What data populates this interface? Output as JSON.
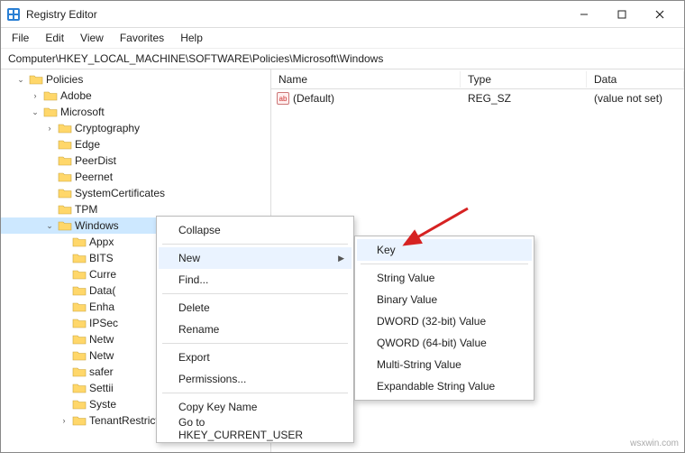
{
  "title": "Registry Editor",
  "menu": {
    "file": "File",
    "edit": "Edit",
    "view": "View",
    "favorites": "Favorites",
    "help": "Help"
  },
  "addr_label": "Computer\\HKEY_LOCAL_MACHINE\\SOFTWARE\\Policies\\Microsoft\\Windows",
  "tree": {
    "root": "Policies",
    "adobe": "Adobe",
    "microsoft": "Microsoft",
    "ms_children": [
      "Cryptography",
      "Edge",
      "PeerDist",
      "Peernet",
      "SystemCertificates",
      "TPM",
      "Windows"
    ],
    "win_children": [
      "Appx",
      "BITS",
      "CurrentVersion",
      "DataCollection",
      "EnhancedStorageDevices",
      "IPSec",
      "NetworkConnectivityStatusIndicator",
      "NetworkProvider",
      "safer",
      "Settings",
      "System",
      "TenantRestrictions"
    ],
    "win_children_display": [
      "Appx",
      "BITS",
      "Curre",
      "Data(",
      "Enha",
      "IPSec",
      "Netw",
      "Netw",
      "safer",
      "Settii",
      "Syste",
      "TenantRestrictions"
    ]
  },
  "list": {
    "cols": {
      "name": "Name",
      "type": "Type",
      "data": "Data"
    },
    "rows": [
      {
        "name": "(Default)",
        "type": "REG_SZ",
        "data": "(value not set)"
      }
    ]
  },
  "ctx1": {
    "collapse": "Collapse",
    "new": "New",
    "find": "Find...",
    "delete": "Delete",
    "rename": "Rename",
    "export": "Export",
    "permissions": "Permissions...",
    "copy_key": "Copy Key Name",
    "goto": "Go to HKEY_CURRENT_USER"
  },
  "ctx2": {
    "key": "Key",
    "string": "String Value",
    "binary": "Binary Value",
    "dword": "DWORD (32-bit) Value",
    "qword": "QWORD (64-bit) Value",
    "multi": "Multi-String Value",
    "expand": "Expandable String Value"
  },
  "watermark": "wsxwin.com"
}
